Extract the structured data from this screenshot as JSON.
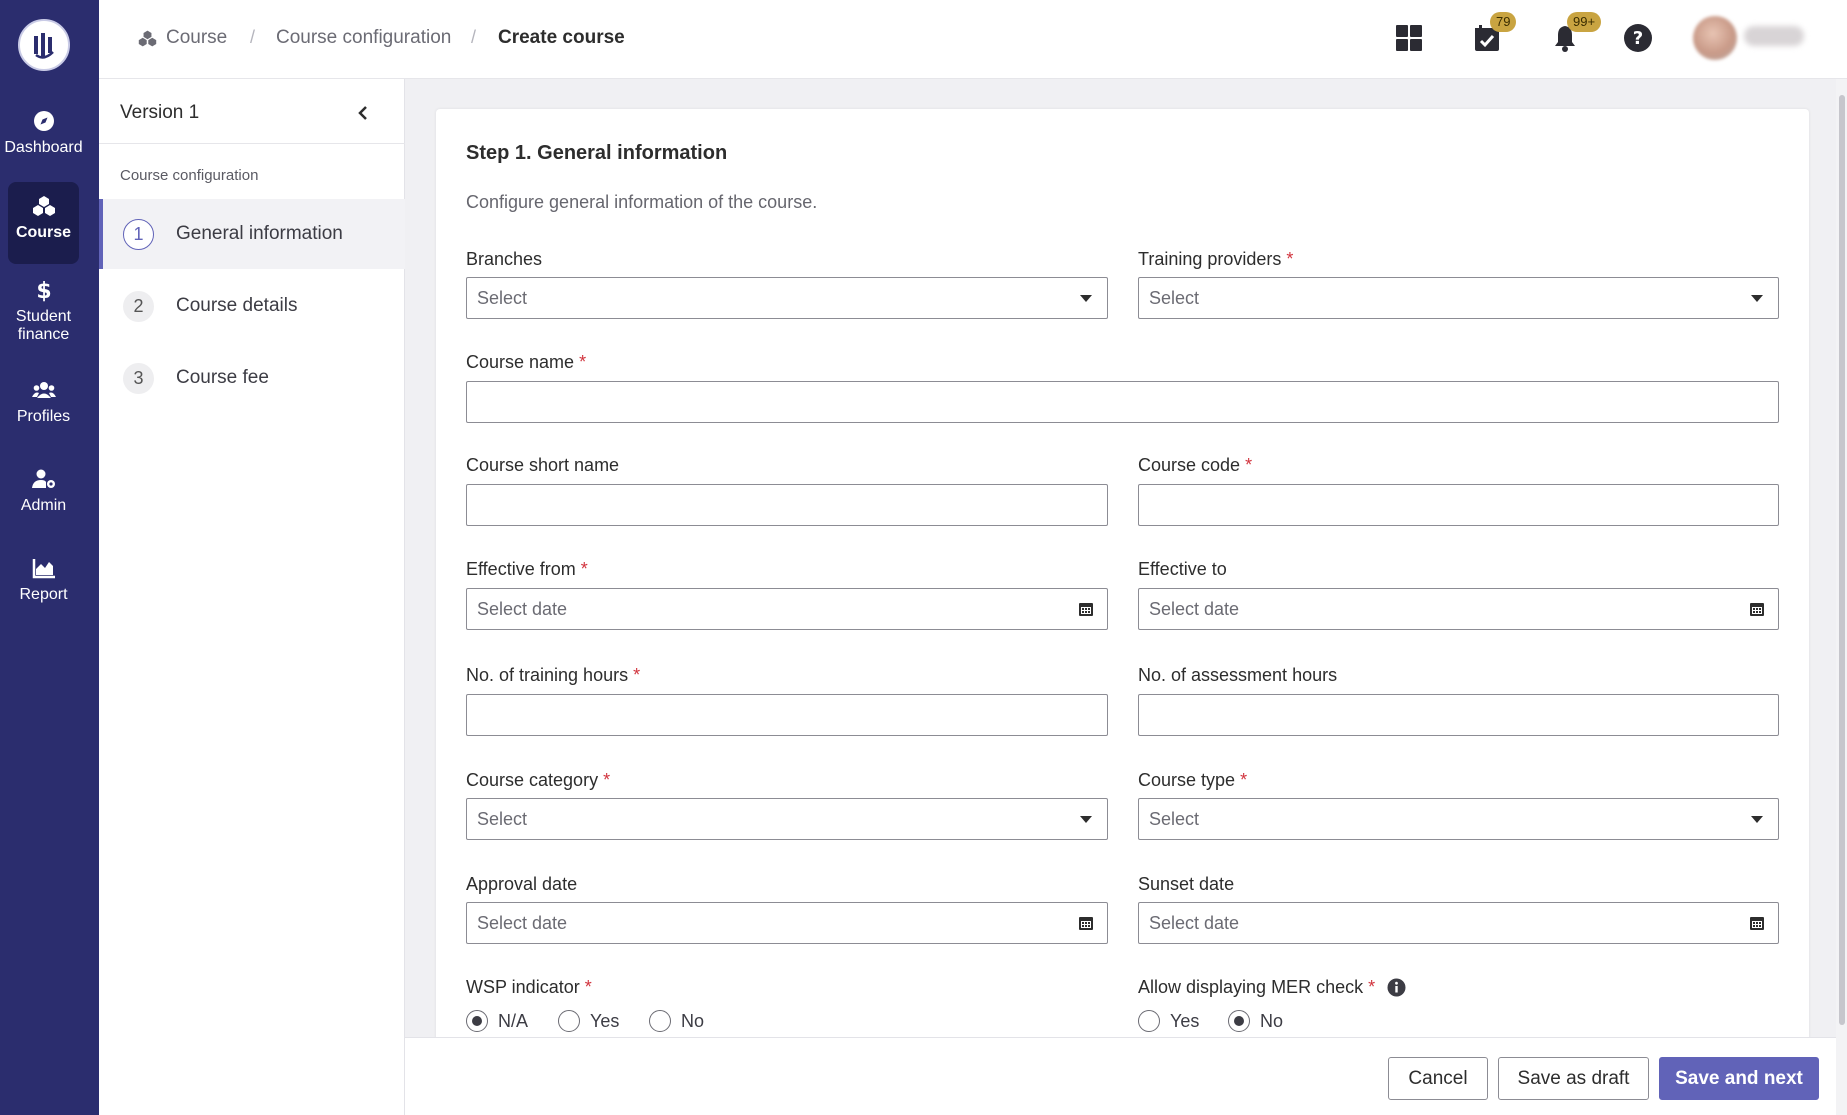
{
  "nav": {
    "items": [
      {
        "label": "Dashboard",
        "icon": "compass-icon"
      },
      {
        "label": "Course",
        "icon": "cubes-icon"
      },
      {
        "label": "Student\nfinance",
        "icon": "dollar-icon"
      },
      {
        "label": "Profiles",
        "icon": "users-icon"
      },
      {
        "label": "Admin",
        "icon": "user-cog-icon"
      },
      {
        "label": "Report",
        "icon": "area-chart-icon"
      }
    ],
    "active": "Course"
  },
  "breadcrumb": {
    "items": [
      "Course",
      "Course configuration",
      "Create course"
    ],
    "separator": "/"
  },
  "header": {
    "tasks_badge": "79",
    "notifications_badge": "99+"
  },
  "version_panel": {
    "title": "Version 1",
    "section": "Course configuration",
    "steps": [
      {
        "num": "1",
        "label": "General information"
      },
      {
        "num": "2",
        "label": "Course details"
      },
      {
        "num": "3",
        "label": "Course fee"
      }
    ]
  },
  "form": {
    "title": "Step 1. General information",
    "description": "Configure general information of the course.",
    "required_mark": "*",
    "branches": {
      "label": "Branches",
      "placeholder": "Select"
    },
    "training_providers": {
      "label": "Training providers",
      "placeholder": "Select"
    },
    "course_name": {
      "label": "Course name",
      "value": ""
    },
    "course_short_name": {
      "label": "Course short name",
      "value": ""
    },
    "course_code": {
      "label": "Course code",
      "value": ""
    },
    "effective_from": {
      "label": "Effective from",
      "placeholder": "Select date"
    },
    "effective_to": {
      "label": "Effective to",
      "placeholder": "Select date"
    },
    "training_hours": {
      "label": "No. of training hours",
      "value": ""
    },
    "assessment_hours": {
      "label": "No. of assessment hours",
      "value": ""
    },
    "course_category": {
      "label": "Course category",
      "placeholder": "Select"
    },
    "course_type": {
      "label": "Course type",
      "placeholder": "Select"
    },
    "approval_date": {
      "label": "Approval date",
      "placeholder": "Select date"
    },
    "sunset_date": {
      "label": "Sunset date",
      "placeholder": "Select date"
    },
    "wsp_indicator": {
      "label": "WSP indicator",
      "options": [
        "N/A",
        "Yes",
        "No"
      ],
      "selected": "N/A"
    },
    "mer_check": {
      "label": "Allow displaying MER check",
      "options": [
        "Yes",
        "No"
      ],
      "selected": "No"
    }
  },
  "footer": {
    "cancel": "Cancel",
    "save_draft": "Save as draft",
    "save_next": "Save and next"
  },
  "colors": {
    "rail": "#2b2d6e",
    "accent": "#6163b8",
    "badge": "#c9a441",
    "required": "#d1333d"
  }
}
